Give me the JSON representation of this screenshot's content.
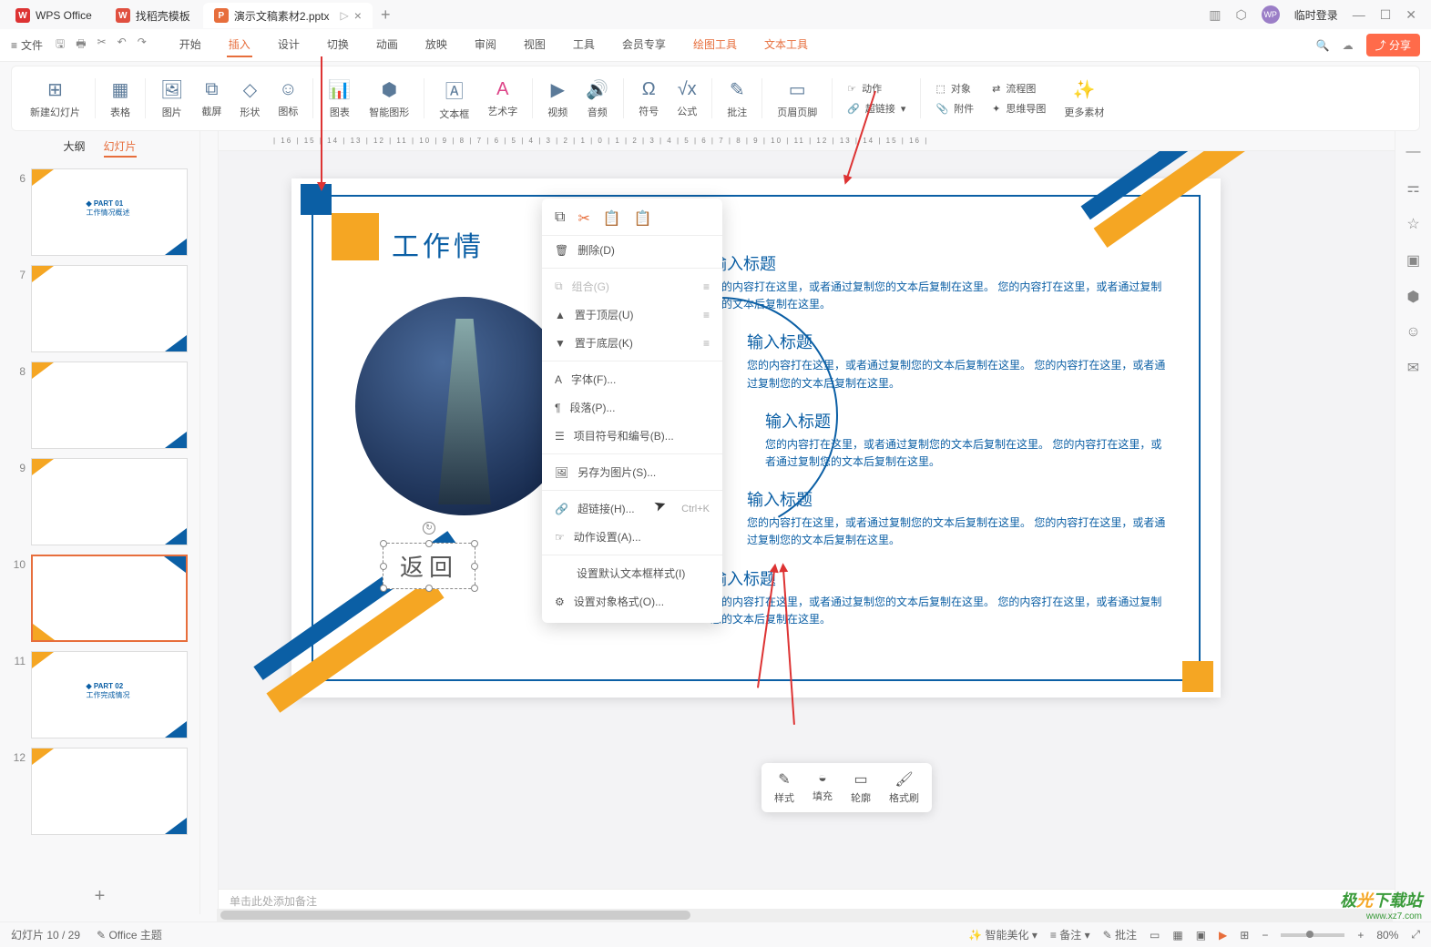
{
  "titlebar": {
    "app": "WPS Office",
    "tabs": [
      {
        "icon_bg": "#e04f3f",
        "icon_text": "W",
        "label": "找稻壳模板"
      },
      {
        "icon_bg": "#e76e3c",
        "icon_text": "P",
        "label": "演示文稿素材2.pptx"
      }
    ],
    "login": "临时登录"
  },
  "menubar": {
    "file": "文件",
    "menus": [
      "开始",
      "插入",
      "设计",
      "切换",
      "动画",
      "放映",
      "审阅",
      "视图",
      "工具",
      "会员专享",
      "绘图工具",
      "文本工具"
    ],
    "active": "插入",
    "share": "分享"
  },
  "ribbon": [
    {
      "label": "新建幻灯片",
      "icon": "▦"
    },
    {
      "label": "表格",
      "icon": "▦"
    },
    {
      "label": "图片",
      "icon": "🖼"
    },
    {
      "label": "截屏",
      "icon": "✂"
    },
    {
      "label": "形状",
      "icon": "◇"
    },
    {
      "label": "图标",
      "icon": "☺"
    },
    {
      "label": "图表",
      "icon": "📊"
    },
    {
      "label": "智能图形",
      "icon": "⬢"
    },
    {
      "label": "文本框",
      "icon": "A"
    },
    {
      "label": "艺术字",
      "icon": "A"
    },
    {
      "label": "视频",
      "icon": "▶"
    },
    {
      "label": "音频",
      "icon": "🔊"
    },
    {
      "label": "符号",
      "icon": "Ω"
    },
    {
      "label": "公式",
      "icon": "π"
    },
    {
      "label": "批注",
      "icon": "✎"
    },
    {
      "label": "页眉页脚",
      "icon": "▭"
    },
    {
      "label": "动作",
      "icon": "☞",
      "label2": "超链接",
      "icon2": "🔗"
    },
    {
      "label": "对象",
      "icon": "⬚",
      "label2": "附件",
      "icon2": "📎"
    },
    {
      "label": "流程图",
      "icon": "⇄",
      "label2": "思维导图",
      "icon2": "✦"
    },
    {
      "label": "更多素材",
      "icon": "✨"
    }
  ],
  "leftpane": {
    "tabs": [
      "大纲",
      "幻灯片"
    ],
    "active": "幻灯片",
    "start": 6,
    "count": 7,
    "selected": 10
  },
  "slide": {
    "title": "工作情",
    "textbox": "返回",
    "items": [
      {
        "title": "输入标题",
        "desc": "您的内容打在这里，或者通过复制您的文本后复制在这里。\n您的内容打在这里，或者通过复制您的文本后复制在这里。"
      },
      {
        "title": "输入标题",
        "desc": "您的内容打在这里，或者通过复制您的文本后复制在这里。\n您的内容打在这里，或者通过复制您的文本后复制在这里。"
      },
      {
        "title": "输入标题",
        "desc": "您的内容打在这里，或者通过复制您的文本后复制在这里。\n您的内容打在这里，或者通过复制您的文本后复制在这里。"
      },
      {
        "title": "输入标题",
        "desc": "您的内容打在这里，或者通过复制您的文本后复制在这里。\n您的内容打在这里，或者通过复制您的文本后复制在这里。"
      },
      {
        "title": "输入标题",
        "desc": "您的内容打在这里，或者通过复制您的文本后复制在这里。\n您的内容打在这里，或者通过复制您的文本后复制在这里。"
      }
    ]
  },
  "contextmenu": {
    "items": [
      {
        "label": "删除(D)"
      },
      {
        "label": "组合(G)",
        "disabled": true,
        "sub": true
      },
      {
        "label": "置于顶层(U)",
        "sub": true
      },
      {
        "label": "置于底层(K)",
        "sub": true
      },
      {
        "label": "字体(F)..."
      },
      {
        "label": "段落(P)..."
      },
      {
        "label": "项目符号和编号(B)..."
      },
      {
        "label": "另存为图片(S)..."
      },
      {
        "label": "超链接(H)...",
        "shortcut": "Ctrl+K"
      },
      {
        "label": "动作设置(A)..."
      },
      {
        "label": "设置默认文本框样式(I)"
      },
      {
        "label": "设置对象格式(O)..."
      }
    ]
  },
  "floatbar": [
    {
      "label": "样式",
      "icon": "✎"
    },
    {
      "label": "填充",
      "icon": "◒"
    },
    {
      "label": "轮廓",
      "icon": "▭"
    },
    {
      "label": "格式刷",
      "icon": "🖌"
    }
  ],
  "notes": "单击此处添加备注",
  "statusbar": {
    "slide": "幻灯片 10 / 29",
    "theme": "Office 主题",
    "beautify": "智能美化",
    "notesbtn": "备注",
    "comments": "批注",
    "zoom": "80%"
  },
  "watermark": {
    "brand": "极光下载站",
    "url": "www.xz7.com"
  }
}
